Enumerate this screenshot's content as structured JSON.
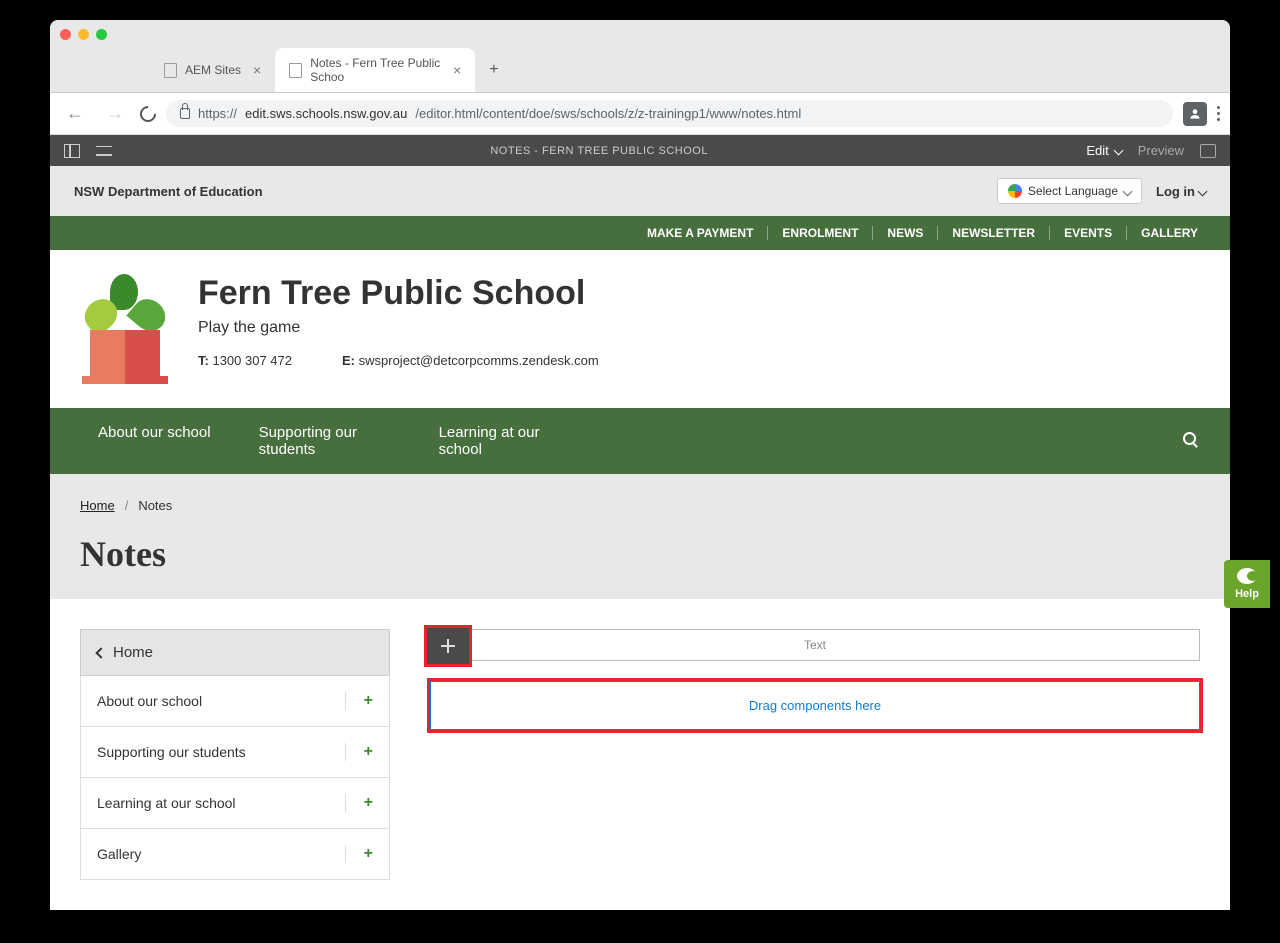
{
  "browser": {
    "tabs": [
      {
        "label": "AEM Sites",
        "active": false
      },
      {
        "label": "Notes - Fern Tree Public Schoo",
        "active": true
      }
    ],
    "url": {
      "host": "edit.sws.schools.nsw.gov.au",
      "path": "/editor.html/content/doe/sws/schools/z/z-trainingp1/www/notes.html",
      "prefix": "https://"
    }
  },
  "aem": {
    "title": "NOTES - FERN TREE PUBLIC SCHOOL",
    "edit": "Edit",
    "preview": "Preview"
  },
  "topstrip": {
    "dept": "NSW Department of Education",
    "lang": "Select Language",
    "login": "Log in"
  },
  "greenlinks": [
    "MAKE A PAYMENT",
    "ENROLMENT",
    "NEWS",
    "NEWSLETTER",
    "EVENTS",
    "GALLERY"
  ],
  "school": {
    "name": "Fern Tree Public School",
    "tagline": "Play the game",
    "tLabel": "T:",
    "phone": "1300 307 472",
    "eLabel": "E:",
    "email": "swsproject@detcorpcomms.zendesk.com"
  },
  "nav": [
    "About our school",
    "Supporting our students",
    "Learning at our school"
  ],
  "crumbs": {
    "home": "Home",
    "current": "Notes"
  },
  "page": {
    "title": "Notes"
  },
  "sidebar": {
    "home": "Home",
    "items": [
      "About our school",
      "Supporting our students",
      "Learning at our school",
      "Gallery"
    ]
  },
  "main": {
    "textLabel": "Text",
    "dropLabel": "Drag components here"
  },
  "help": "Help"
}
